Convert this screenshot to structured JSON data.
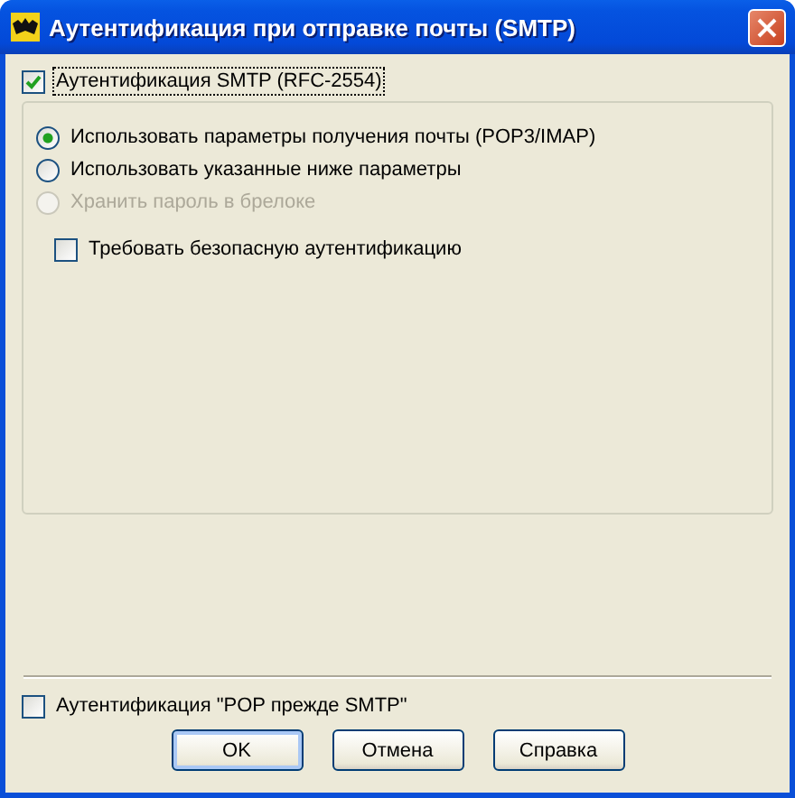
{
  "window": {
    "title": "Аутентификация при отправке почты (SMTP)"
  },
  "smtp_auth": {
    "label": "Аутентификация SMTP (RFC-2554)",
    "checked": true
  },
  "options": [
    {
      "kind": "radio",
      "label": "Использовать параметры получения почты (POP3/IMAP)",
      "selected": true,
      "disabled": false
    },
    {
      "kind": "radio",
      "label": "Использовать указанные ниже параметры",
      "selected": false,
      "disabled": false
    },
    {
      "kind": "radio",
      "label": "Хранить пароль в брелоке",
      "selected": false,
      "disabled": true
    },
    {
      "kind": "checkbox",
      "label": "Требовать безопасную аутентификацию",
      "checked": false,
      "disabled": false
    }
  ],
  "pop_before_smtp": {
    "label": "Аутентификация \"POP прежде SMTP\"",
    "checked": false
  },
  "buttons": [
    {
      "label": "OK",
      "default": true
    },
    {
      "label": "Отмена",
      "default": false
    },
    {
      "label": "Справка",
      "default": false
    }
  ]
}
